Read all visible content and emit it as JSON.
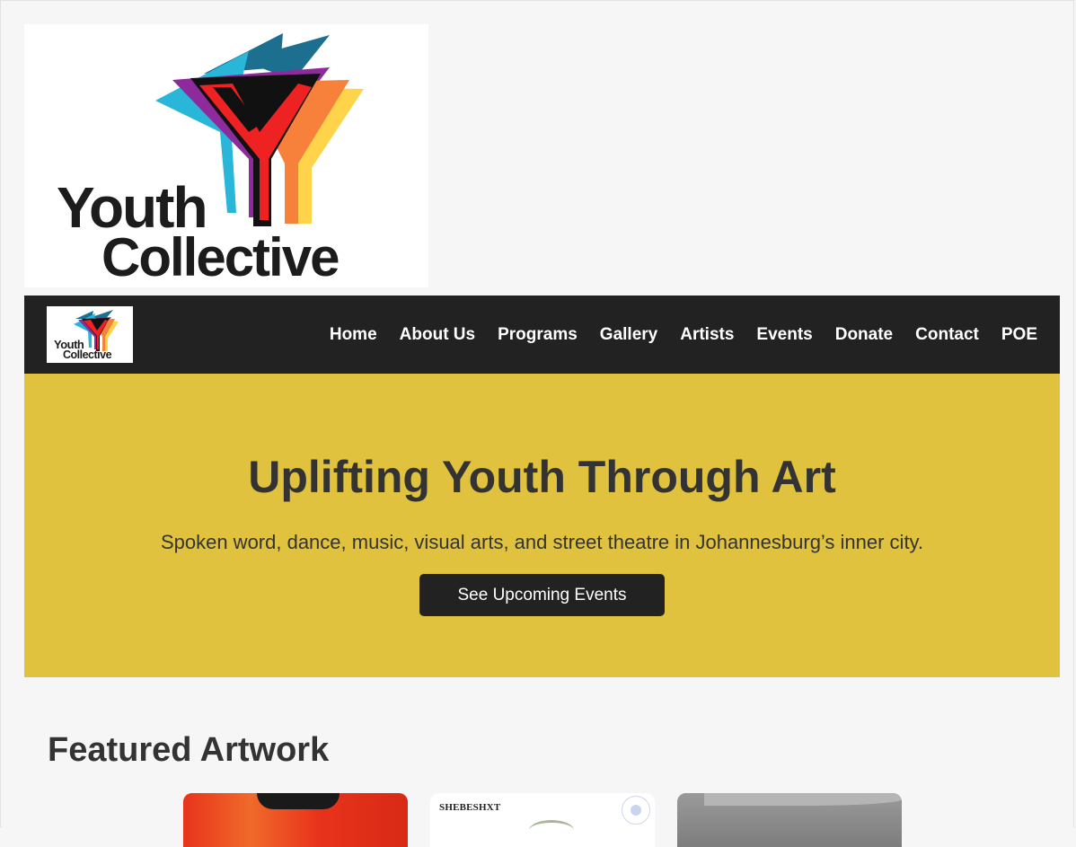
{
  "brand": {
    "logo_line1": "Youth",
    "logo_line2": "Collective"
  },
  "nav": {
    "items": [
      {
        "label": "Home"
      },
      {
        "label": "About Us"
      },
      {
        "label": "Programs"
      },
      {
        "label": "Gallery"
      },
      {
        "label": "Artists"
      },
      {
        "label": "Events"
      },
      {
        "label": "Donate"
      },
      {
        "label": "Contact"
      },
      {
        "label": "POE"
      }
    ]
  },
  "hero": {
    "title": "Uplifting Youth Through Art",
    "subtitle": "Spoken word, dance, music, visual arts, and street theatre in Johannesburg’s inner city.",
    "cta_label": "See Upcoming Events"
  },
  "featured": {
    "title": "Featured Artwork",
    "artworks": [
      {
        "kind": "portrait-red"
      },
      {
        "kind": "poster",
        "brand_text": "SHEBESHXT"
      },
      {
        "kind": "sketch-grey"
      }
    ]
  },
  "colors": {
    "page_bg": "#f6f6f6",
    "nav_bg": "#222222",
    "hero_bg": "#e0c23e",
    "cta_bg": "#222222",
    "logo_cyan": "#29b6d8",
    "logo_purple": "#8e2a9c",
    "logo_red": "#ee2222",
    "logo_orange": "#f7803a",
    "logo_yellow": "#ffd34a",
    "logo_teal": "#1c6f8f"
  }
}
